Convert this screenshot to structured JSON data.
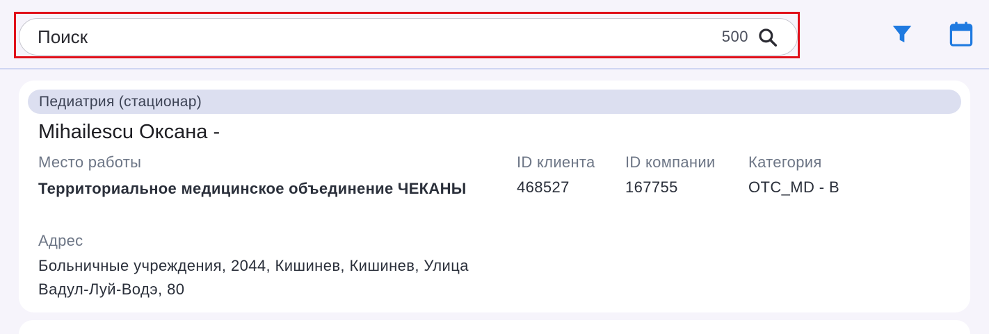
{
  "search": {
    "placeholder": "Поиск",
    "count": "500"
  },
  "toolbar": {
    "search_icon": "search-icon",
    "filter_icon": "filter-icon",
    "calendar_icon": "calendar-icon",
    "accent_color": "#1f7ae0"
  },
  "card": {
    "category": "Педиатрия (стационар)",
    "name": "Mihailescu Оксана -",
    "workplace_label": "Место работы",
    "workplace_value": "Территориальное медицинское объединение ЧЕКАНЫ",
    "address_label": "Адрес",
    "address_value": "Больничные учреждения, 2044, Кишинев, Кишинев, Улица Вадул-Луй-Водэ, 80",
    "client_id_label": "ID клиента",
    "client_id_value": "468527",
    "company_id_label": "ID компании",
    "company_id_value": "167755",
    "category_label": "Категория",
    "category_value": "OTC_MD - B"
  }
}
